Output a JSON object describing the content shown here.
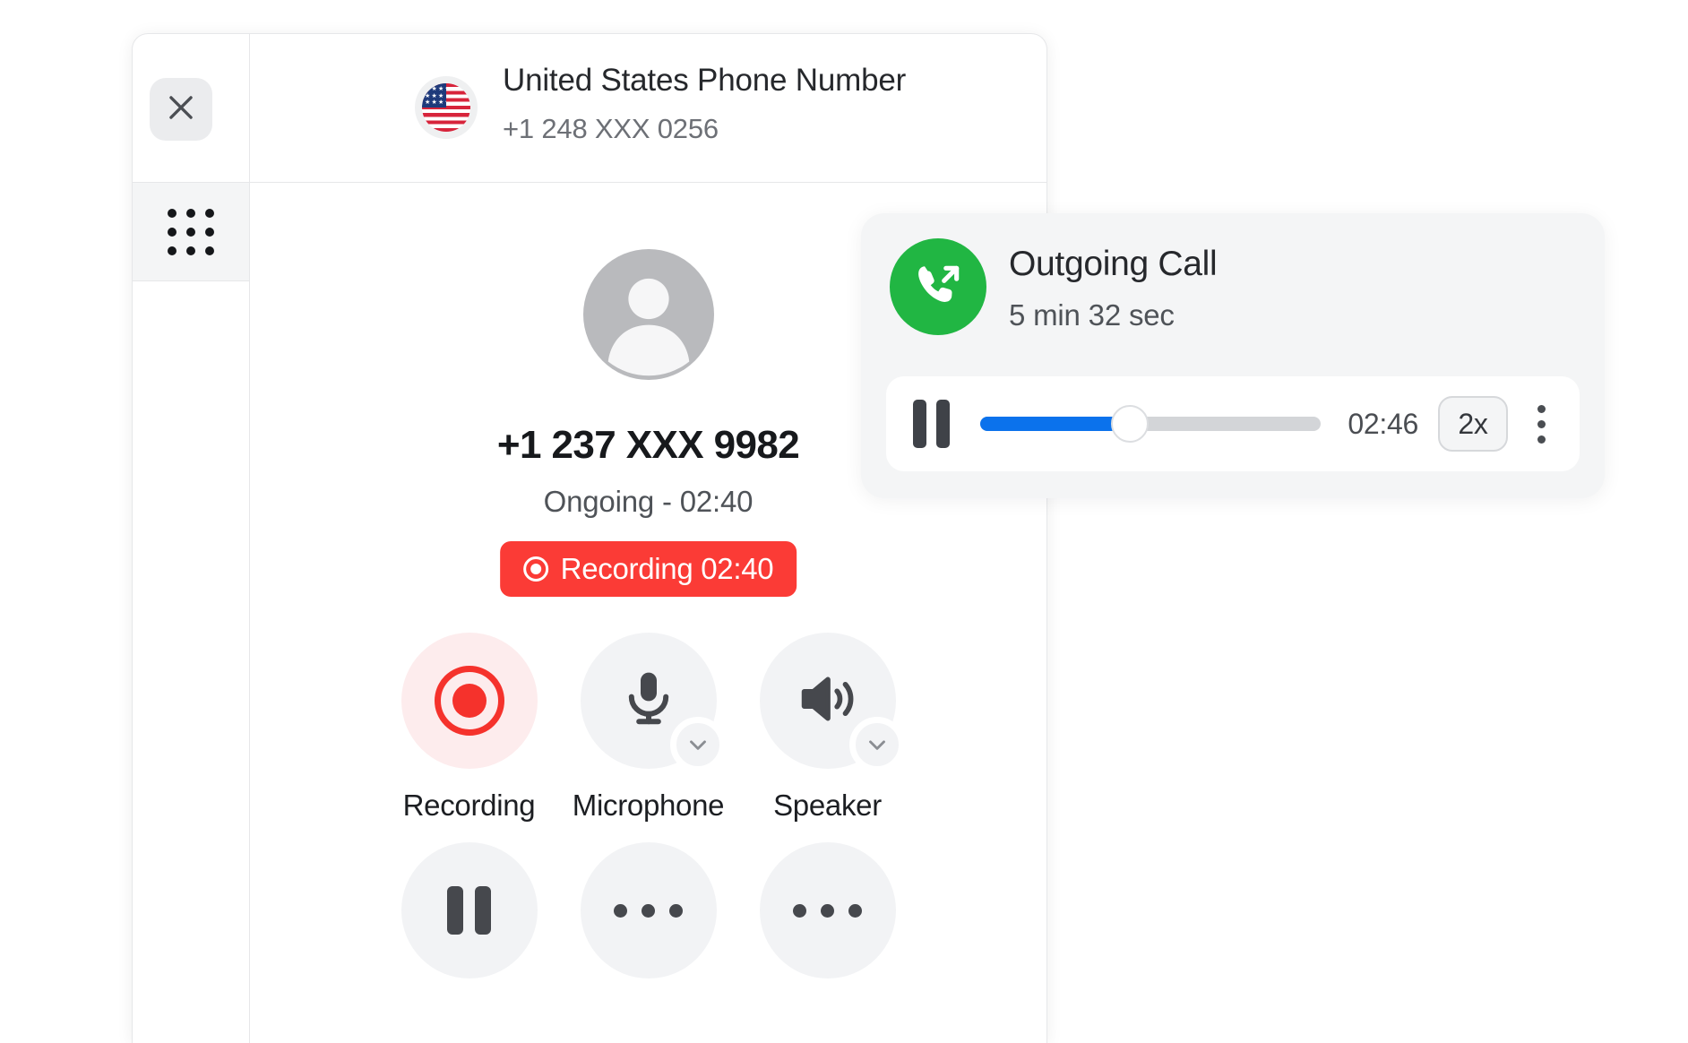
{
  "window": {
    "background_color": "#ffffff"
  },
  "dialer": {
    "rail": {
      "close_icon": "close-icon",
      "apps_grid_icon": "apps-grid-icon"
    },
    "header": {
      "flag_icon": "us-flag-icon",
      "title": "United States Phone Number",
      "subtitle": "+1 248 XXX 0256",
      "expand_icon": "chevron-down-icon"
    },
    "call": {
      "avatar_icon": "person-avatar-icon",
      "number": "+1 237 XXX 9982",
      "status": "Ongoing - 02:40",
      "recording_badge": {
        "icon": "record-dot-icon",
        "label": "Recording 02:40",
        "color": "#fb3b36"
      }
    },
    "controls": [
      {
        "icon": "record-circle-icon",
        "label": "Recording",
        "active": true,
        "has_chevron": false,
        "accent": "#f5322c",
        "bg": "#fdeced"
      },
      {
        "icon": "microphone-icon",
        "label": "Microphone",
        "active": false,
        "has_chevron": true,
        "accent": "#46484d",
        "bg": "#f2f3f5"
      },
      {
        "icon": "speaker-icon",
        "label": "Speaker",
        "active": false,
        "has_chevron": true,
        "accent": "#46484d",
        "bg": "#f2f3f5"
      },
      {
        "icon": "pause-icon",
        "label": "",
        "active": false,
        "has_chevron": false,
        "accent": "#46484d",
        "bg": "#f2f3f5"
      },
      {
        "icon": "more-dots-icon",
        "label": "",
        "active": false,
        "has_chevron": false,
        "accent": "#46484d",
        "bg": "#f2f3f5"
      },
      {
        "icon": "keypad-dots-icon",
        "label": "",
        "active": false,
        "has_chevron": false,
        "accent": "#46484d",
        "bg": "#f2f3f5"
      }
    ]
  },
  "call_card": {
    "phone_icon": "outgoing-call-icon",
    "icon_color": "#21b643",
    "title": "Outgoing Call",
    "duration": "5 min 32 sec",
    "player": {
      "pause_icon": "pause-icon",
      "progress_percent": 44,
      "progress_color": "#0b72ec",
      "time": "02:46",
      "speed": "2x",
      "more_icon": "more-vertical-icon"
    }
  }
}
